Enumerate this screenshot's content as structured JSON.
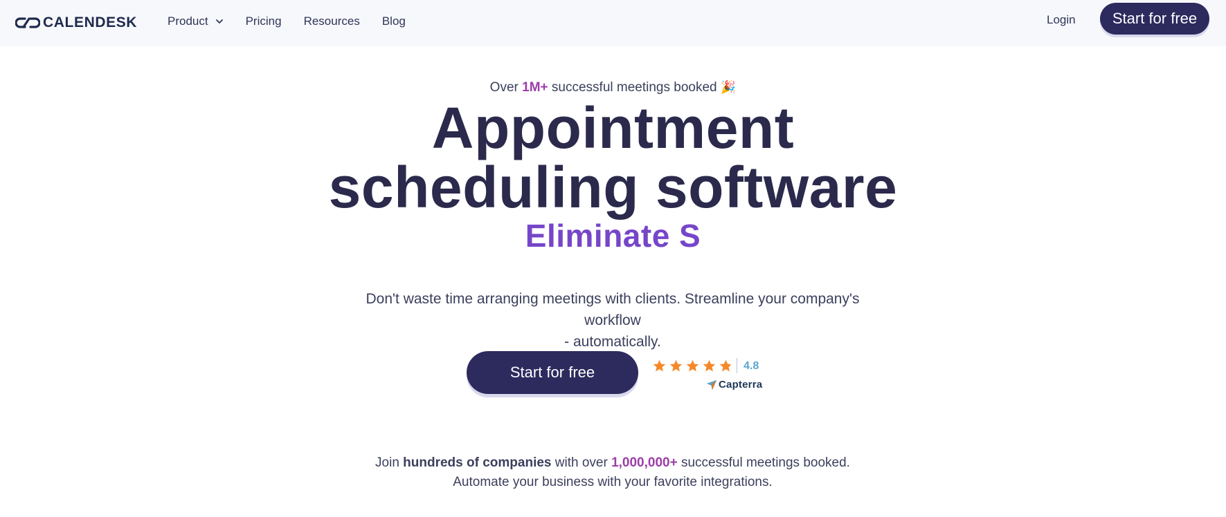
{
  "header": {
    "logo_text": "CALENDESK",
    "nav": [
      {
        "label": "Product",
        "has_dropdown": true
      },
      {
        "label": "Pricing"
      },
      {
        "label": "Resources"
      },
      {
        "label": "Blog"
      }
    ],
    "login_label": "Login",
    "cta_label": "Start for free"
  },
  "hero": {
    "kicker_prefix": "Over",
    "kicker_highlight": "1M+",
    "kicker_suffix": "successful meetings booked",
    "kicker_emoji": "🎉",
    "headline_line1": "Appointment",
    "headline_line2": "scheduling software",
    "typing_text": "Eliminate S",
    "description_line1": "Don't waste time arranging meetings with clients. Streamline your company's workflow",
    "description_line2": "- automatically.",
    "cta_label": "Start for free",
    "rating": {
      "score": "4.8",
      "stars": 4.8,
      "source": "Capterra"
    }
  },
  "social_proof": {
    "join": "Join",
    "bold_companies": "hundreds of companies",
    "with_over": "with over",
    "count": "1,000,000+",
    "booked": "successful meetings booked.",
    "line2": "Automate your business with your favorite integrations."
  },
  "colors": {
    "primary": "#2d2a5e",
    "headline": "#2b2a4c",
    "typing_accent": "#7646c9",
    "highlight": "#9c3ea8",
    "star": "#f5892a",
    "rating_score": "#5aa6cf",
    "header_bg": "#f7f8fc"
  }
}
